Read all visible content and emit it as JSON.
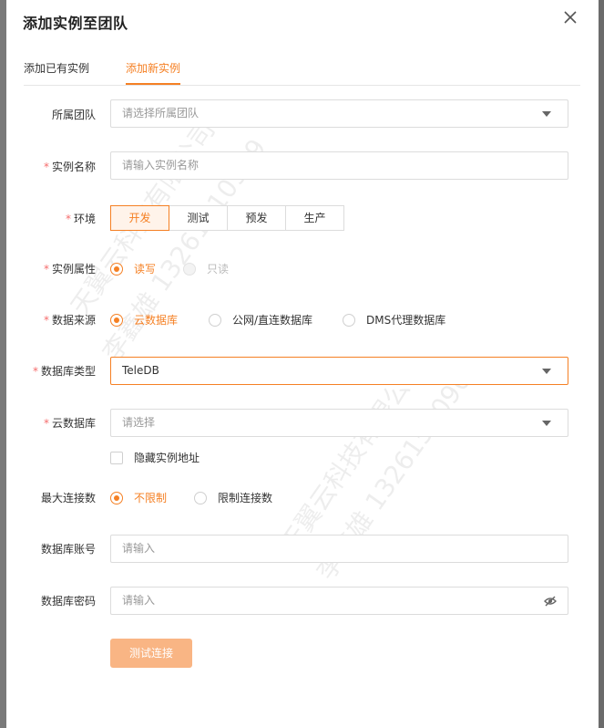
{
  "dialog": {
    "title": "添加实例至团队",
    "tabs": [
      {
        "label": "添加已有实例",
        "active": false
      },
      {
        "label": "添加新实例",
        "active": true
      }
    ]
  },
  "form": {
    "team": {
      "label": "所属团队",
      "placeholder": "请选择所属团队"
    },
    "instance_name": {
      "label": "实例名称",
      "placeholder": "请输入实例名称",
      "required": true
    },
    "environment": {
      "label": "环境",
      "required": true,
      "options": [
        "开发",
        "测试",
        "预发",
        "生产"
      ],
      "selected": "开发"
    },
    "instance_attr": {
      "label": "实例属性",
      "required": true,
      "options": [
        "读写",
        "只读"
      ],
      "selected": "读写"
    },
    "data_source": {
      "label": "数据来源",
      "required": true,
      "options": [
        "云数据库",
        "公网/直连数据库",
        "DMS代理数据库"
      ],
      "selected": "云数据库"
    },
    "db_type": {
      "label": "数据库类型",
      "required": true,
      "value": "TeleDB"
    },
    "cloud_db": {
      "label": "云数据库",
      "required": true,
      "placeholder": "请选择"
    },
    "hide_address": {
      "label": "隐藏实例地址",
      "checked": false
    },
    "max_connections": {
      "label": "最大连接数",
      "options": [
        "不限制",
        "限制连接数"
      ],
      "selected": "不限制"
    },
    "db_account": {
      "label": "数据库账号",
      "placeholder": "请输入"
    },
    "db_password": {
      "label": "数据库密码",
      "placeholder": "请输入"
    },
    "test_button": "测试连接"
  },
  "watermark": {
    "line1": "天翼云科技有限公司",
    "line2": "李鑫雄 13261510909"
  },
  "colors": {
    "accent": "#f58024",
    "required": "#f56c6c",
    "button_disabled": "#f9b584"
  },
  "icons": {
    "close": "close-icon",
    "caret": "caret-down-icon",
    "eye": "eye-hidden-icon"
  }
}
